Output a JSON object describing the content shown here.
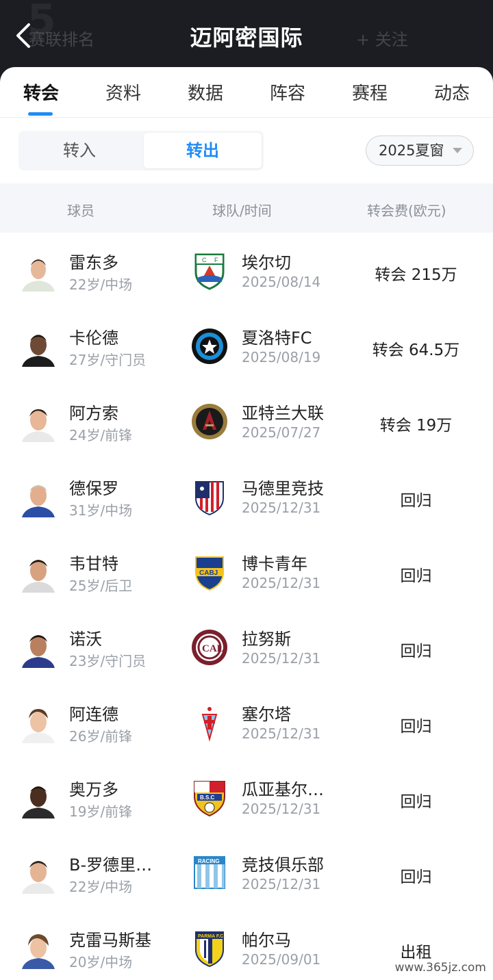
{
  "header": {
    "title": "迈阿密国际",
    "ghost_left": "赛联排名",
    "ghost_right": "+ 关注"
  },
  "tabs": [
    {
      "label": "转会",
      "active": true
    },
    {
      "label": "资料"
    },
    {
      "label": "数据"
    },
    {
      "label": "阵容"
    },
    {
      "label": "赛程"
    },
    {
      "label": "动态"
    }
  ],
  "segment": {
    "in_label": "转入",
    "out_label": "转出",
    "selected": "转出"
  },
  "window_select": {
    "value": "2025夏窗"
  },
  "columns": {
    "player": "球员",
    "team_time": "球队/时间",
    "fee": "转会费(欧元)"
  },
  "transfers": [
    {
      "name": "雷东多",
      "meta": "22岁/中场",
      "team": "埃尔切",
      "date": "2025/08/14",
      "fee": "转会 215万",
      "crest": "elche-crest-icon"
    },
    {
      "name": "卡伦德",
      "meta": "27岁/守门员",
      "team": "夏洛特FC",
      "date": "2025/08/19",
      "fee": "转会 64.5万",
      "crest": "charlotte-crest-icon"
    },
    {
      "name": "阿方索",
      "meta": "24岁/前锋",
      "team": "亚特兰大联",
      "date": "2025/07/27",
      "fee": "转会 19万",
      "crest": "atlanta-crest-icon"
    },
    {
      "name": "德保罗",
      "meta": "31岁/中场",
      "team": "马德里竞技",
      "date": "2025/12/31",
      "fee": "回归",
      "crest": "atletico-crest-icon"
    },
    {
      "name": "韦甘特",
      "meta": "25岁/后卫",
      "team": "博卡青年",
      "date": "2025/12/31",
      "fee": "回归",
      "crest": "boca-crest-icon"
    },
    {
      "name": "诺沃",
      "meta": "23岁/守门员",
      "team": "拉努斯",
      "date": "2025/12/31",
      "fee": "回归",
      "crest": "lanus-crest-icon"
    },
    {
      "name": "阿连德",
      "meta": "26岁/前锋",
      "team": "塞尔塔",
      "date": "2025/12/31",
      "fee": "回归",
      "crest": "celta-crest-icon"
    },
    {
      "name": "奥万多",
      "meta": "19岁/前锋",
      "team": "瓜亚基尔…",
      "date": "2025/12/31",
      "fee": "回归",
      "crest": "barcelona-sc-crest-icon"
    },
    {
      "name": "B-罗德里…",
      "meta": "22岁/中场",
      "team": "竞技俱乐部",
      "date": "2025/12/31",
      "fee": "回归",
      "crest": "racing-crest-icon"
    },
    {
      "name": "克雷马斯基",
      "meta": "20岁/中场",
      "team": "帕尔马",
      "date": "2025/09/01",
      "fee": "出租",
      "crest": "parma-crest-icon"
    }
  ],
  "watermark": "www.365jz.com",
  "colors": {
    "accent": "#1f8cf7",
    "header_bg": "#1b1d22"
  }
}
